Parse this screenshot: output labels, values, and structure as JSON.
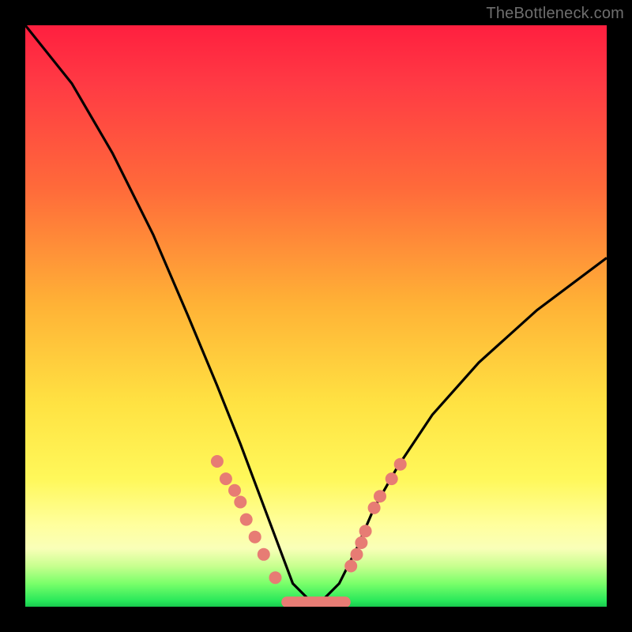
{
  "watermark": "TheBottleneck.com",
  "colors": {
    "frame": "#000000",
    "curve": "#000000",
    "marker": "#e77c74",
    "gradient_stops": [
      "#ff1f3f",
      "#ff6a3a",
      "#ffe242",
      "#ffff9e",
      "#28e85a"
    ]
  },
  "chart_data": {
    "type": "line",
    "title": "",
    "xlabel": "",
    "ylabel": "",
    "x_range": [
      0,
      100
    ],
    "y_range": [
      0,
      100
    ],
    "note": "V-shaped bottleneck curve; y≈100 at x≈0, minimum y≈0 around x≈45–55, rising to y≈60 at x≈100. Values estimated from geometry; no axis ticks shown.",
    "series": [
      {
        "name": "bottleneck-curve",
        "x": [
          0,
          8,
          15,
          22,
          28,
          33,
          37,
          40,
          43,
          46,
          50,
          54,
          57,
          60,
          64,
          70,
          78,
          88,
          100
        ],
        "y": [
          100,
          90,
          78,
          64,
          50,
          38,
          28,
          20,
          12,
          4,
          0,
          4,
          10,
          17,
          24,
          33,
          42,
          51,
          60
        ]
      }
    ],
    "left_markers": {
      "name": "left-branch-points",
      "x": [
        33.0,
        34.5,
        36.0,
        37.0,
        38.0,
        39.5,
        41.0,
        43.0
      ],
      "y": [
        25.0,
        22.0,
        20.0,
        18.0,
        15.0,
        12.0,
        9.0,
        5.0
      ]
    },
    "right_markers": {
      "name": "right-branch-points",
      "x": [
        56.0,
        57.0,
        57.8,
        58.5,
        60.0,
        61.0,
        63.0,
        64.5
      ],
      "y": [
        7.0,
        9.0,
        11.0,
        13.0,
        17.0,
        19.0,
        22.0,
        24.5
      ]
    },
    "flat_segment": {
      "name": "bottom-flat",
      "x_start": 45,
      "x_end": 55,
      "y": 0.8
    }
  }
}
